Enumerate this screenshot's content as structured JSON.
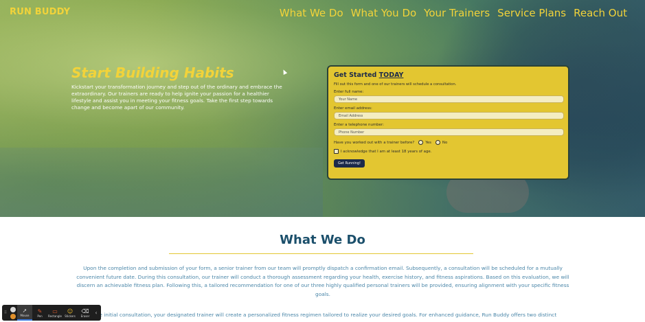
{
  "brand": {
    "name": "RUN BUDDY"
  },
  "nav": [
    {
      "label": "What We Do"
    },
    {
      "label": "What You Do"
    },
    {
      "label": "Your Trainers"
    },
    {
      "label": "Service Plans"
    },
    {
      "label": "Reach Out"
    }
  ],
  "hero": {
    "title": "Start Building Habits",
    "text": "Kickstart your transformation journey and step out of the ordinary and embrace the extraordinary. Our trainers are ready to help ignite your passion for a healthier lifestyle and assist you in meeting your fitness goals. Take the first step towards change and become apart of our community."
  },
  "form": {
    "heading": "Get Started",
    "heading_emphasis": "TODAY",
    "subtitle": "Fill out this form and one of our trainers will schedule a consultation.",
    "name_label": "Enter full name:",
    "name_placeholder": "Your Name",
    "email_label": "Enter email address:",
    "email_placeholder": "Email Address",
    "phone_label": "Enter a telephone number:",
    "phone_placeholder": "Phone Number",
    "trainer_question": "Have you worked out with a trainer before?",
    "option_yes": "Yes",
    "option_no": "No",
    "age_ack": "I acknowledge that I am at least 18 years of age.",
    "submit": "Get Running!"
  },
  "what_we_do": {
    "title": "What We Do",
    "paragraph1": "Upon the completion and submission of your form, a senior trainer from our team will promptly dispatch a confirmation email. Subsequently, a consultation will be scheduled for a mutually convenient future date. During this consultation, our trainer will conduct a thorough assessment regarding your health, exercise history, and fitness aspirations. Based on this evaluation, we will discern an achievable fitness plan. Following this, a tailored recommendation for one of our three highly qualified personal trainers will be provided, ensuring alignment with your specific fitness goals.",
    "paragraph2": "g the initial consultation, your designated trainer will create a personalized fitness regimen tailored to realize your desired goals. For enhanced guidance, Run Buddy offers two distinct"
  },
  "toolbar": {
    "tools": [
      {
        "label": "Mouse",
        "icon": "cursor-icon",
        "glyph": "➚",
        "active": true
      },
      {
        "label": "Pen",
        "icon": "pen-icon",
        "glyph": "✎",
        "active": false
      },
      {
        "label": "Rectangle",
        "icon": "rectangle-icon",
        "glyph": "▭",
        "active": false
      },
      {
        "label": "Stickers",
        "icon": "sticker-icon",
        "glyph": "☺",
        "active": false
      },
      {
        "label": "Eraser",
        "icon": "eraser-icon",
        "glyph": "⌫",
        "active": false
      }
    ],
    "collapse_glyph": "‹"
  },
  "colors": {
    "accent_yellow": "#f2d33a",
    "card_yellow": "#e3c631",
    "heading_blue": "#1b4f6b",
    "body_blue": "#4a86a8",
    "button_navy": "#1c2a4a"
  }
}
